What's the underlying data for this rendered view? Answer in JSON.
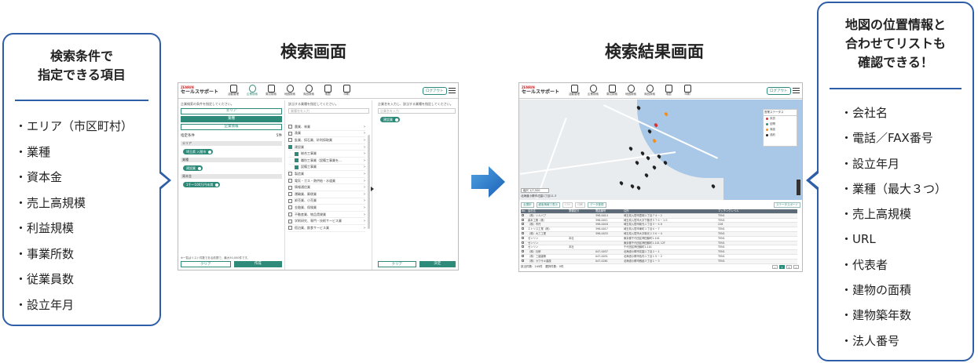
{
  "left_callout": {
    "heading": [
      "検索条件で",
      "指定できる項目"
    ],
    "items": [
      "・エリア（市区町村）",
      "・業種",
      "・資本金",
      "・売上高規模",
      "・利益規模",
      "・事業所数",
      "・従業員数",
      "・設立年月"
    ]
  },
  "right_callout": {
    "heading": [
      "地図の位置情報と",
      "合わせてリストも",
      "確認できる！"
    ],
    "items": [
      "・会社名",
      "・電話／FAX番号",
      "・設立年月",
      "・業種（最大３つ）",
      "・売上高規模",
      "・URL",
      "・代表者",
      "・建物の面積",
      "・建物築年数",
      "・法人番号"
    ]
  },
  "titles": {
    "search": "検索画面",
    "result": "検索結果画面"
  },
  "app": {
    "brand_top": "ZENRIN",
    "brand_name": "セールスサポート",
    "logout": "ログアウト",
    "nav": [
      "活動管理",
      "企業検索",
      "周辺検索",
      "地図検索",
      "商品検索",
      "地図",
      "印刷"
    ]
  },
  "search_screen": {
    "col1_hint": "企業検索の条件を指定してください。",
    "btn_area": "エリア",
    "btn_industry": "業種",
    "btn_company": "企業情報",
    "cond_label": "指定条件",
    "cond_count": "5件",
    "sec_area": "エリア",
    "chip_area": "埼玉県 入間市",
    "sec_industry": "業種",
    "chip_industry": "建設業",
    "sec_capital": "資本金",
    "chip_capital": "1千～100万円未満",
    "note": "※一覧はリスト件数である前提で、最大50,000件です。",
    "btn_clear": "クリア",
    "btn_create": "作成",
    "col2_hint": "該当する業種を指定してください。",
    "col2_search": "業種名を入力",
    "industries": [
      {
        "label": "農業、林業",
        "checked": false,
        "sub": false
      },
      {
        "label": "漁業",
        "checked": false,
        "sub": false
      },
      {
        "label": "鉱業、採石業、砂利採取業",
        "checked": false,
        "sub": false
      },
      {
        "label": "建設業",
        "checked": true,
        "sub": false
      },
      {
        "label": "総合工事業",
        "checked": true,
        "sub": true
      },
      {
        "label": "職別工事業（設備工事業を…",
        "checked": true,
        "sub": true
      },
      {
        "label": "設備工事業",
        "checked": true,
        "sub": true
      },
      {
        "label": "製造業",
        "checked": false,
        "sub": false
      },
      {
        "label": "電気・ガス・熱供給・水道業",
        "checked": false,
        "sub": false
      },
      {
        "label": "情報通信業",
        "checked": false,
        "sub": false
      },
      {
        "label": "運輸業、郵便業",
        "checked": false,
        "sub": false
      },
      {
        "label": "卸売業、小売業",
        "checked": false,
        "sub": false
      },
      {
        "label": "金融業、保険業",
        "checked": false,
        "sub": false
      },
      {
        "label": "不動産業、物品賃貸業",
        "checked": false,
        "sub": false
      },
      {
        "label": "学術研究、専門・技術サービス業",
        "checked": false,
        "sub": false
      },
      {
        "label": "宿泊業、飲食サービス業",
        "checked": false,
        "sub": false
      }
    ],
    "col3_hint": "企業名を入力し、該当する業種を指定してください。",
    "col3_search": "企業名を入力",
    "chip_col3": "建設業",
    "btn_clear2": "クリア",
    "btn_decide": "決定"
  },
  "result_screen": {
    "legend_title": "営業ステータス",
    "legend": [
      {
        "label": "未訪",
        "color": "#d33"
      },
      {
        "label": "訪問",
        "color": "#2e8b7a"
      },
      {
        "label": "商談",
        "color": "#f0901e"
      },
      {
        "label": "成約",
        "color": "#222"
      }
    ],
    "map_scale": "縮尺 1/7,500",
    "map_address": "北海道小樽市花園1丁目11-3",
    "toolbar": [
      "全選択",
      "顧客情報で表示",
      "CSV",
      "印刷",
      "データ登録"
    ],
    "toolbar_right": "ステータスボード",
    "columns": [
      "No",
      "会社名",
      "業種区分",
      "電話番号",
      "住所",
      "マッチングレベル"
    ],
    "rows": [
      {
        "name": "（株）シルバブ",
        "kind": "",
        "tel": "398-0014",
        "addr": "埼玉県入間市豊岡１丁目７４－２",
        "lv": "TEN1"
      },
      {
        "name": "森本工務（株）",
        "kind": "",
        "tel": "398-0011",
        "addr": "埼玉県入間市大字下藤沢５７６－１６",
        "lv": "TEN1"
      },
      {
        "name": "（株）市丹",
        "kind": "",
        "tel": "398-0018",
        "addr": "埼玉県入間市新光１丁目３－４８",
        "lv": "226"
      },
      {
        "name": "エトリス工業（株）",
        "kind": "",
        "tel": "398-0017",
        "addr": "埼玉県入間市東町１丁目６－７",
        "lv": "TEN1"
      },
      {
        "name": "（株）大三工業",
        "kind": "",
        "tel": "398-0033",
        "addr": "埼玉県入間市大字新光２３６－４",
        "lv": "TEN1"
      },
      {
        "name": "ゼンリン",
        "kind": "本社",
        "tel": "",
        "addr": "東京都千代田区神田錦町1-101",
        "lv": "TEN1"
      },
      {
        "name": "ゼンリン",
        "kind": "",
        "tel": "",
        "addr": "東京都千代田区神田錦町1-101 12F",
        "lv": "TEN1"
      },
      {
        "name": "ゼンリン",
        "kind": "本社",
        "tel": "",
        "addr": "千代田区神田錦町1-101",
        "lv": "TEN1"
      },
      {
        "name": "（株）社研",
        "kind": "",
        "tel": "047-0037",
        "addr": "北海道小樽市花園１丁目２－１",
        "lv": "TEN1"
      },
      {
        "name": "（株）三建建築",
        "kind": "",
        "tel": "047-0031",
        "addr": "北海道小樽市色内１丁目１５－２",
        "lv": "TEN1"
      },
      {
        "name": "（株）カワサキ建設",
        "kind": "",
        "tel": "047-0261",
        "addr": "北海道小樽市銭函３丁目１－３",
        "lv": "TEN1"
      }
    ],
    "footer": "該当件数：245件　選択件数：0件",
    "pages": [
      "<",
      "1",
      "2",
      ">"
    ]
  }
}
